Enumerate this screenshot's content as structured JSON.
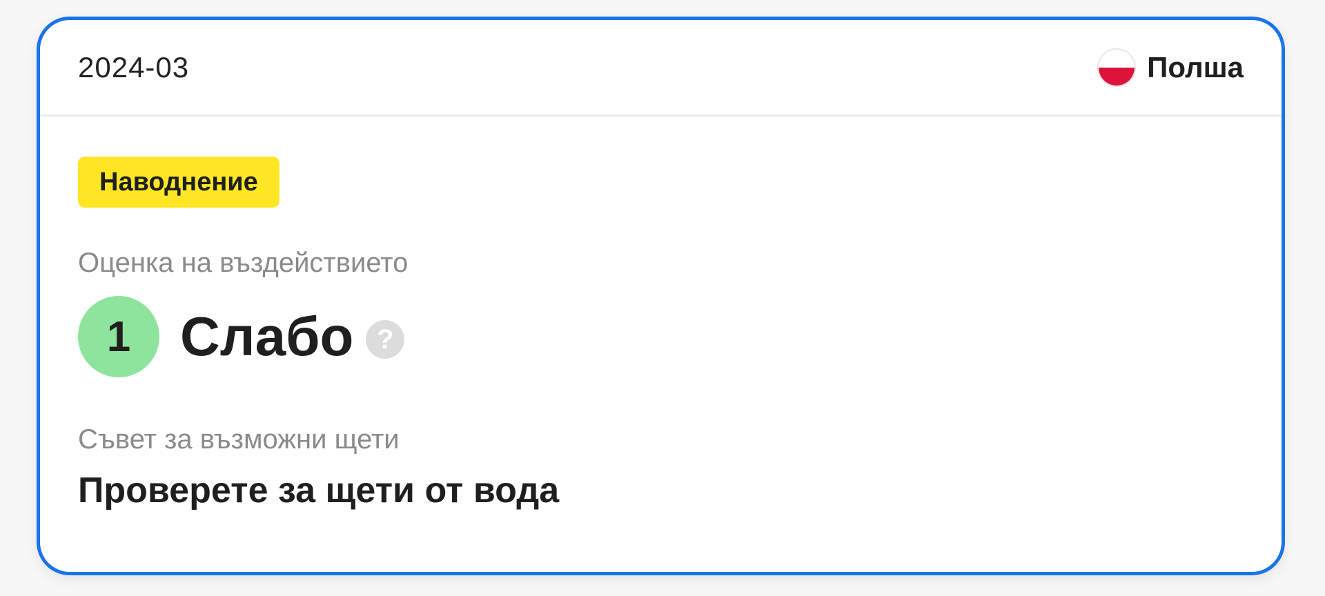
{
  "card": {
    "date": "2024-03",
    "country": {
      "name": "Полша",
      "flag_icon": "poland-flag-icon",
      "flag_colors": [
        "#ffffff",
        "#dc143c"
      ]
    },
    "event_tag": {
      "label": "Наводнение",
      "color": "#ffe625"
    },
    "impact": {
      "label": "Оценка на въздействието",
      "level": "1",
      "level_text": "Слабо",
      "level_color": "#8ee49c",
      "help_icon": "question-mark-icon",
      "help_glyph": "?"
    },
    "advice": {
      "label": "Съвет за възможни щети",
      "text": "Проверете за щети от вода"
    },
    "border_color": "#1a73e8"
  }
}
